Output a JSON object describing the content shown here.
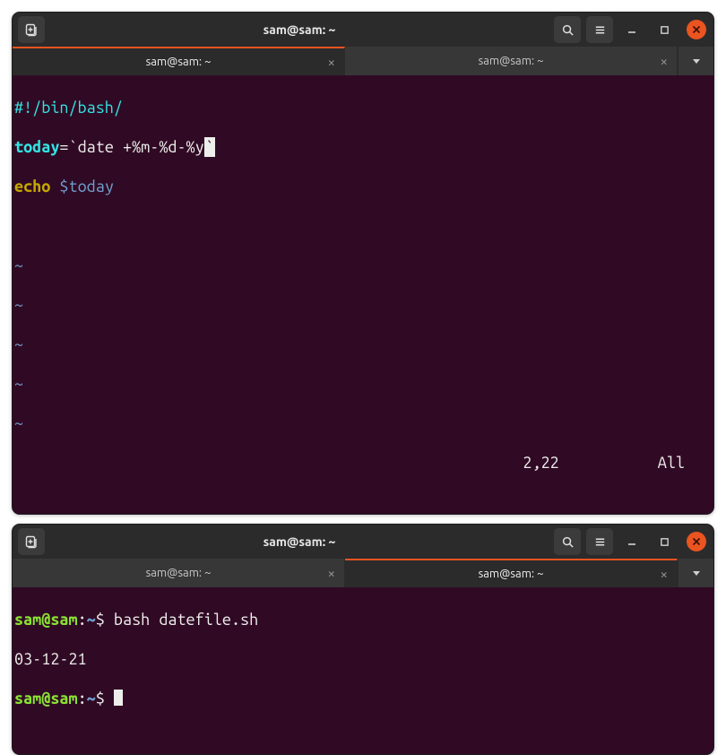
{
  "window1": {
    "title": "sam@sam: ~",
    "tabs": [
      {
        "label": "sam@sam: ~",
        "active": true
      },
      {
        "label": "sam@sam: ~",
        "active": false
      }
    ],
    "editor": {
      "line1_shebang": "#!/bin/bash/",
      "line2_var": "today",
      "line2_eq": "=",
      "line2_tick1": "`",
      "line2_cmd": "date +%m-%d-%y",
      "line2_tick2": "`",
      "line3_echo": "echo",
      "line3_space": " ",
      "line3_var": "$today",
      "tilde": "~",
      "status_pos": "2,22",
      "status_scroll": "All"
    }
  },
  "window2": {
    "title": "sam@sam: ~",
    "tabs": [
      {
        "label": "sam@sam: ~",
        "active": false
      },
      {
        "label": "sam@sam: ~",
        "active": true
      }
    ],
    "shell": {
      "prompt_user": "sam@sam",
      "prompt_sep": ":",
      "prompt_path": "~",
      "prompt_dollar": "$ ",
      "cmd1": "bash datefile.sh",
      "output1": "03-12-21"
    }
  }
}
